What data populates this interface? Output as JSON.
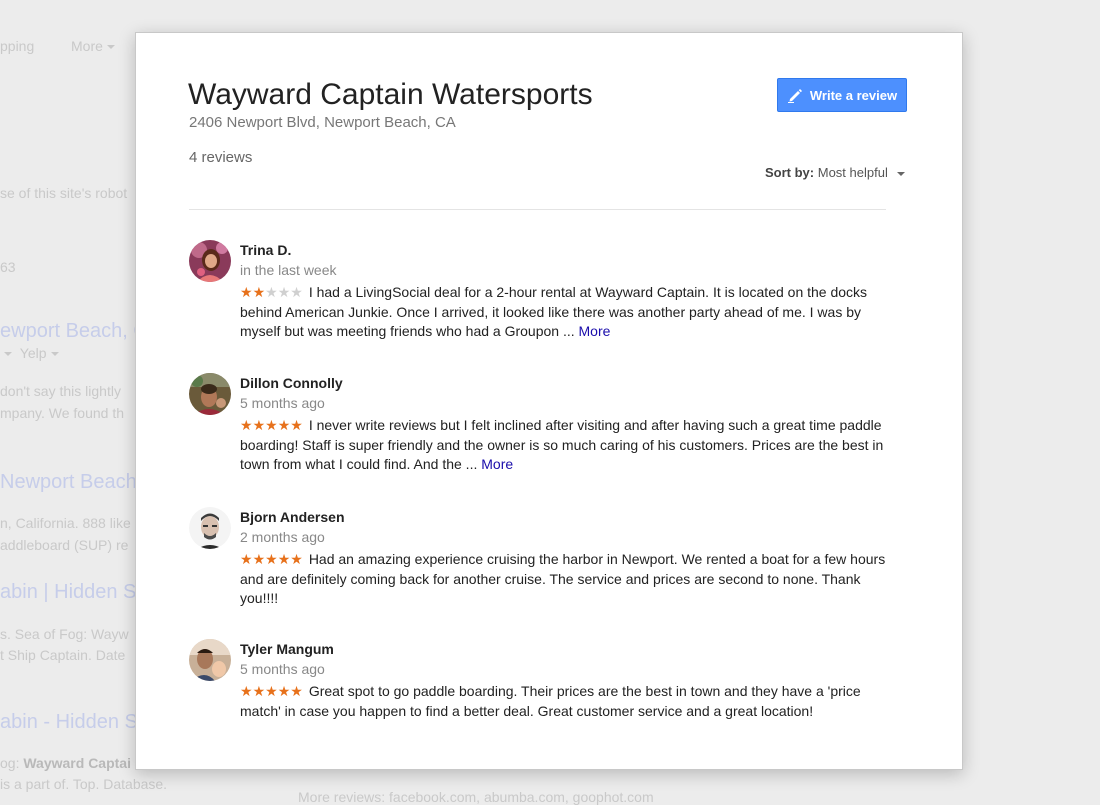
{
  "background": {
    "items": [
      {
        "text": "pping"
      },
      {
        "text": "More"
      },
      {
        "text": "se of this site's robot"
      },
      {
        "text": "63"
      },
      {
        "text": "ewport Beach, C"
      },
      {
        "text": "Yelp"
      },
      {
        "text": "don't say this lightly"
      },
      {
        "text": "mpany. We found th"
      },
      {
        "text": "Newport Beach"
      },
      {
        "text": "n, California. 888 like"
      },
      {
        "text": "addleboard (SUP) re"
      },
      {
        "text": "abin | Hidden St"
      },
      {
        "text": "s. Sea of Fog: Wayw"
      },
      {
        "text": "t Ship Captain. Date"
      },
      {
        "text": "abin - Hidden S"
      },
      {
        "text_prefix": "og: ",
        "text_bold": "Wayward Captai"
      },
      {
        "text": "is a part of. Top. Database."
      },
      {
        "text": "More reviews: facebook.com, abumba.com, goophot.com"
      }
    ]
  },
  "dialog": {
    "title": "Wayward Captain Watersports",
    "address": "2406 Newport Blvd, Newport Beach, CA",
    "review_count": "4 reviews",
    "write_review_label": "Write a review",
    "sort_label": "Sort by:",
    "sort_value": "Most helpful",
    "colors": {
      "accent": "#4d90fe",
      "star": "#e7711b",
      "link": "#1a0dab"
    }
  },
  "reviews": [
    {
      "name": "Trina D.",
      "time": "in the last week",
      "rating": 2,
      "text": "I had a LivingSocial deal for a 2-hour rental at Wayward Captain. It is located on the docks behind American Junkie. Once I arrived, it looked like there was another party ahead of me. I was by myself but was meeting friends who had a Groupon ... ",
      "more": "More"
    },
    {
      "name": "Dillon Connolly",
      "time": "5 months ago",
      "rating": 5,
      "text": "I never write reviews but I felt inclined after visiting and after having such a great time paddle boarding! Staff is super friendly and the owner is so much caring of his customers. Prices are the best in town from what I could find. And the ... ",
      "more": "More"
    },
    {
      "name": "Bjorn Andersen",
      "time": "2 months ago",
      "rating": 5,
      "text": "Had an amazing experience cruising the harbor in Newport. We rented a boat for a few hours and are definitely coming back for another cruise. The service and prices are second to none. Thank you!!!!",
      "more": ""
    },
    {
      "name": "Tyler Mangum",
      "time": "5 months ago",
      "rating": 5,
      "text": "Great spot to go paddle boarding. Their prices are the best in town and they have a 'price match' in case you happen to find a better deal. Great customer service and a great location!",
      "more": ""
    }
  ]
}
